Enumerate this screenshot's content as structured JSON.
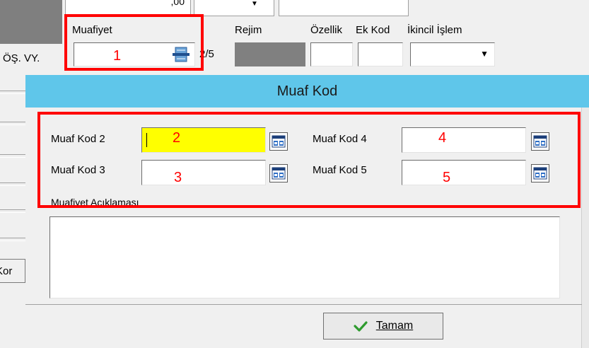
{
  "top_form": {
    "partial_value": ",00",
    "muafiyet_label": "Muafiyet",
    "rejim_label": "Rejim",
    "ozellik_label": "Özellik",
    "ek_kod_label": "Ek Kod",
    "ikincil_islem_label": "İkincil İşlem",
    "left_label": "ÖŞ. VY.",
    "page_indicator": "2/5",
    "marker_1": "1"
  },
  "dialog": {
    "title": "Muaf Kod",
    "fields": [
      {
        "label": "Muaf Kod 2",
        "value": "",
        "marker": "2"
      },
      {
        "label": "Muaf Kod 3",
        "value": "",
        "marker": "3"
      },
      {
        "label": "Muaf Kod 4",
        "value": "",
        "marker": "4"
      },
      {
        "label": "Muaf Kod 5",
        "value": "",
        "marker": "5"
      }
    ],
    "description_label": "Muafiyet Açıklaması",
    "description_value": "",
    "ok_button": "Tamam",
    "left_fragment": "Kor"
  },
  "colors": {
    "title_bar": "#5fc6ea",
    "active_field": "#ffff00",
    "annotation": "#ff0000",
    "ok_check": "#2e9b2e"
  }
}
